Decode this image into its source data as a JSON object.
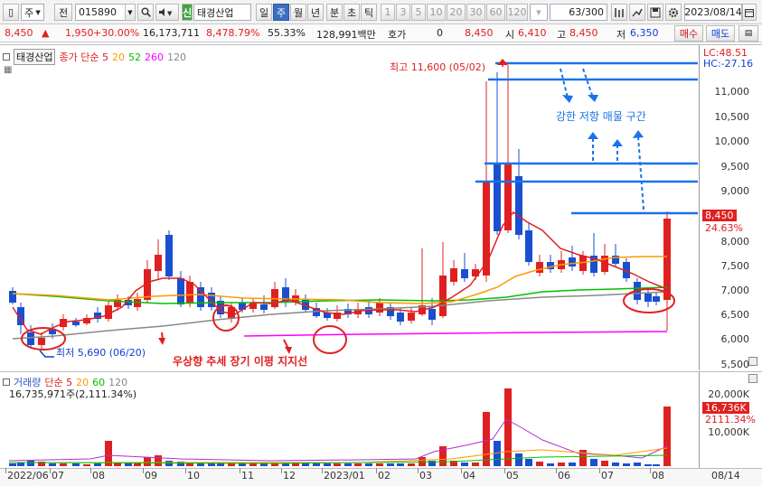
{
  "toolbar": {
    "type_select": "주",
    "mode_button": "전",
    "code": "015890",
    "badge": "신",
    "name": "태경산업",
    "periods": [
      "일",
      "주",
      "월",
      "년",
      "분",
      "초",
      "틱"
    ],
    "intervals": [
      "1",
      "3",
      "5",
      "10",
      "20",
      "30",
      "60",
      "120"
    ],
    "counter": "63/300",
    "date": "2023/08/14"
  },
  "quote": {
    "price": "8,450",
    "change": "1,950",
    "rate": "+30.00%",
    "volume": "16,173,711",
    "vol_ratio": "8,478.79%",
    "turnover": "55.33%",
    "amount": "128,991백만",
    "hoga_label": "호가",
    "hoga_value": "0",
    "ask": "8,450",
    "open_label": "시",
    "open": "6,410",
    "high_label": "고",
    "high": "8,450",
    "low_label": "저",
    "low": "6,350",
    "buy_label": "매수",
    "sell_label": "매도"
  },
  "price_panel": {
    "stock_tag": "태경산업",
    "legend": [
      {
        "text": "종가 단순 5",
        "color": "#e02020"
      },
      {
        "text": "20",
        "color": "#ff9900"
      },
      {
        "text": "52",
        "color": "#00c000"
      },
      {
        "text": "260",
        "color": "#ff00ff"
      },
      {
        "text": "120",
        "color": "#888888"
      }
    ],
    "lc": "LC:48.51",
    "hc": "HC:-27.16",
    "y_ticks": [
      "11,000",
      "10,500",
      "10,000",
      "9,500",
      "9,000",
      "8,500",
      "8,000",
      "7,500",
      "7,000",
      "6,500",
      "6,000",
      "5,500"
    ],
    "price_badge": "8,450",
    "pct_badge": "24.63%",
    "high_note": "최고 11,600 (05/02)",
    "low_note": "최저 5,690 (06/20)",
    "resistance_note": "강한 저항 매물 구간",
    "support_note": "우상향 추세 장기 이평 지지선"
  },
  "volume_panel": {
    "legend": [
      {
        "text": "거래량",
        "color": "#2a56c8"
      },
      {
        "text": "단순 5",
        "color": "#e02020"
      },
      {
        "text": "20",
        "color": "#ff9900"
      },
      {
        "text": "60",
        "color": "#00c000"
      },
      {
        "text": "120",
        "color": "#888888"
      }
    ],
    "summary": "16,735,971주(2,111.34%)",
    "y_ticks": [
      "20,000K",
      "10,000K"
    ],
    "vol_badge": "16,736K",
    "vol_pct": "2111.34%"
  },
  "x_axis": [
    "2022/06",
    "07",
    "08",
    "09",
    "10",
    "11",
    "12",
    "2023/01",
    "02",
    "03",
    "04",
    "05",
    "06",
    "07",
    "08",
    "08/14"
  ],
  "colors": {
    "up": "#e02020",
    "down": "#1a4fd0",
    "accent": "#2a56a0"
  }
}
